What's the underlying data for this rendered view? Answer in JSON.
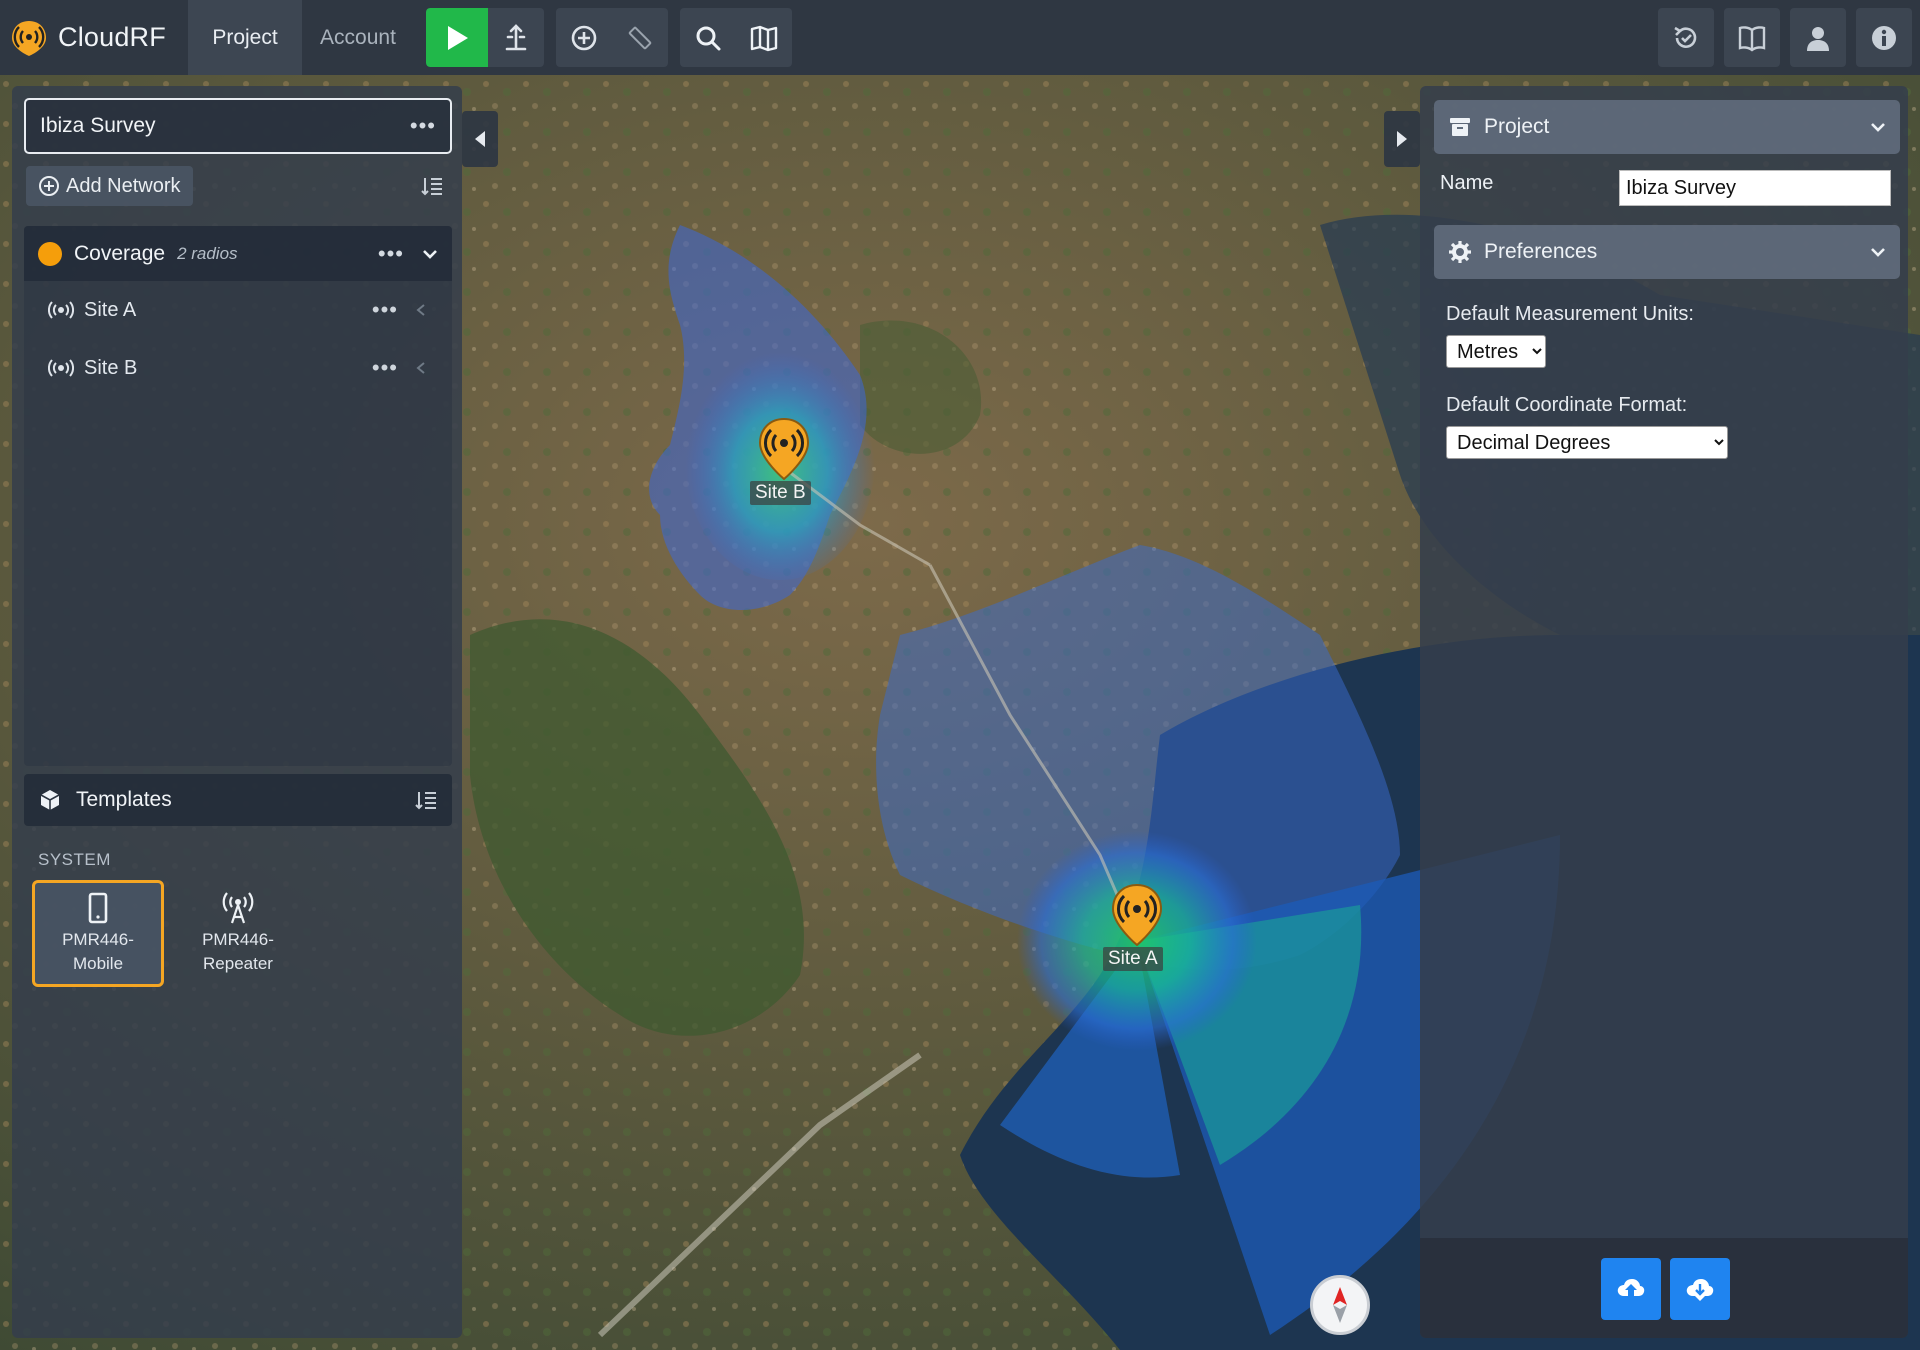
{
  "app": {
    "name": "CloudRF",
    "accent": "#21b84a",
    "brand_color": "#f59e0b"
  },
  "nav": {
    "tabs": [
      {
        "label": "Project",
        "active": true
      },
      {
        "label": "Account",
        "active": false
      }
    ]
  },
  "toolbar": {
    "icons": [
      "play-icon",
      "upload-tower-icon",
      "add-circle-icon",
      "ruler-icon",
      "search-icon",
      "map-book-icon"
    ],
    "right_icons": [
      "history-icon",
      "book-icon",
      "user-icon",
      "info-icon"
    ]
  },
  "left_panel": {
    "project_title": "Ibiza Survey",
    "add_network_label": "Add Network",
    "network": {
      "name": "Coverage",
      "count": "2 radios",
      "color": "#f59e0b",
      "sites": [
        {
          "name": "Site A"
        },
        {
          "name": "Site B"
        }
      ]
    },
    "templates": {
      "label": "Templates",
      "section": "SYSTEM",
      "items": [
        {
          "line1": "PMR446-",
          "line2": "Mobile",
          "selected": true
        },
        {
          "line1": "PMR446-",
          "line2": "Repeater",
          "selected": false
        }
      ]
    }
  },
  "map": {
    "markers": [
      {
        "label": "Site B"
      },
      {
        "label": "Site A"
      }
    ]
  },
  "right_panel": {
    "project_section": "Project",
    "name_label": "Name",
    "name_value": "Ibiza Survey",
    "preferences_section": "Preferences",
    "units_label": "Default Measurement Units:",
    "units_value": "Metres",
    "coord_label": "Default Coordinate Format:",
    "coord_value": "Decimal Degrees"
  }
}
